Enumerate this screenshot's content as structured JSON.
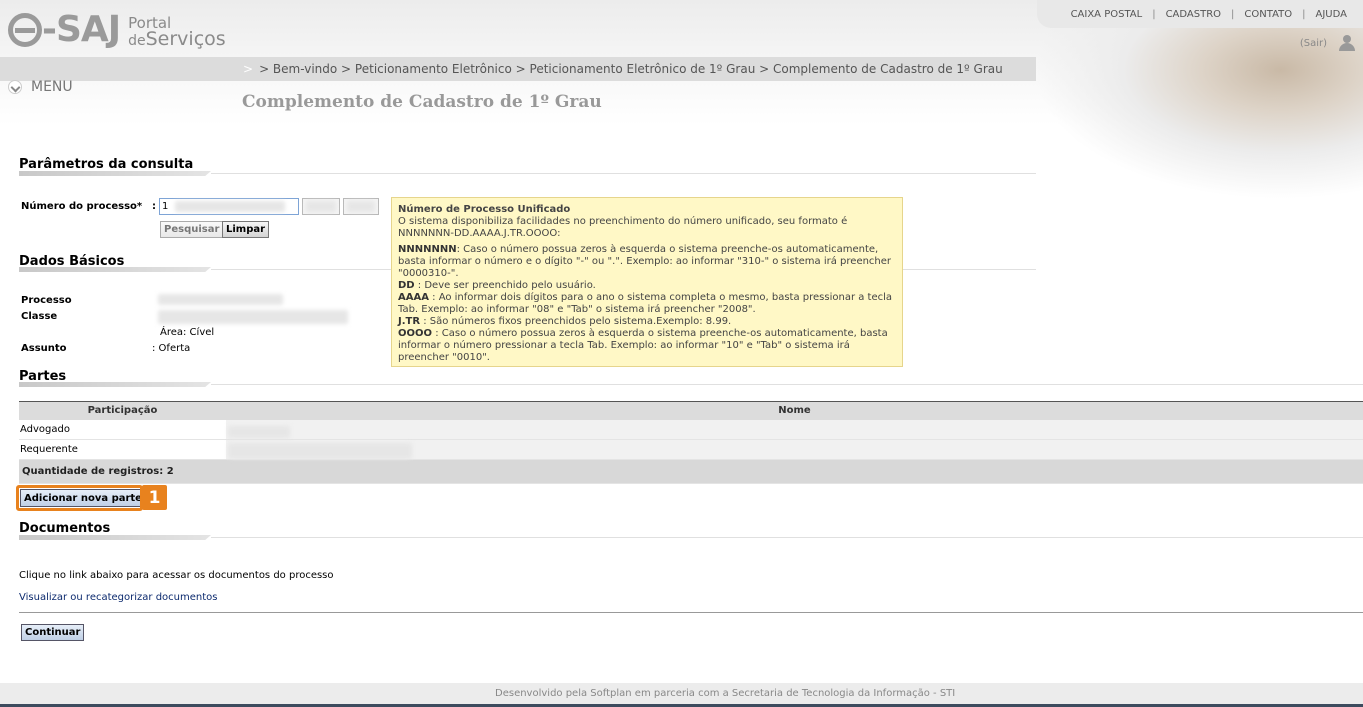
{
  "header": {
    "logo_main": "-SAJ",
    "logo_line1": "Portal",
    "logo_line2_small": "de",
    "logo_line2": "Serviços",
    "top_links": [
      "CAIXA POSTAL",
      "CADASTRO",
      "CONTATO",
      "AJUDA"
    ],
    "separator": "|",
    "logout": "(Sair)",
    "menu_label": "MENU",
    "breadcrumb_arrow": ">",
    "breadcrumb": "> Bem-vindo > Peticionamento Eletrônico > Peticionamento Eletrônico de 1º Grau > Complemento de Cadastro de 1º Grau",
    "page_title": "Complemento de Cadastro de 1º Grau"
  },
  "params": {
    "section_title": "Parâmetros da consulta",
    "process_label": "Número do processo*",
    "colon": ":",
    "process_value": "1",
    "search_button": "Pesquisar",
    "clear_button": "Limpar"
  },
  "tooltip": {
    "title": "Número de Processo Unificado",
    "intro": "O sistema disponibiliza facilidades no preenchimento do número unificado, seu formato é NNNNNNN-DD.AAAA.J.TR.OOOO:",
    "items": [
      {
        "key": "NNNNNNN",
        "text": ": Caso o número possua zeros à esquerda o sistema preenche-os automaticamente, basta informar o número e o dígito \"-\" ou \".\". Exemplo: ao informar \"310-\" o sistema irá preencher \"0000310-\"."
      },
      {
        "key": "DD",
        "text": " : Deve ser preenchido pelo usuário."
      },
      {
        "key": "AAAA",
        "text": " : Ao informar dois dígitos para o ano o sistema completa o mesmo, basta pressionar a tecla Tab. Exemplo: ao informar \"08\" e \"Tab\" o sistema irá preencher \"2008\"."
      },
      {
        "key": "J.TR",
        "text": " : São números fixos preenchidos pelo sistema.Exemplo: 8.99."
      },
      {
        "key": "OOOO",
        "text": " : Caso o número possua zeros à esquerda o sistema preenche-os automaticamente, basta informar o número pressionar a tecla Tab. Exemplo: ao informar \"10\" e \"Tab\" o sistema irá preencher \"0010\"."
      }
    ]
  },
  "basic": {
    "section_title": "Dados Básicos",
    "processo_label": "Processo",
    "classe_label": "Classe",
    "area_text": "Área: Cível",
    "assunto_label": "Assunto",
    "assunto_value": ": Oferta"
  },
  "partes": {
    "section_title": "Partes",
    "col_participacao": "Participação",
    "col_nome": "Nome",
    "rows": [
      {
        "participacao": "Advogado"
      },
      {
        "participacao": "Requerente"
      }
    ],
    "total": "Quantidade de registros: 2",
    "add_button": "Adicionar nova parte",
    "badge": "1"
  },
  "documentos": {
    "section_title": "Documentos",
    "info": "Clique no link abaixo para acessar os documentos do processo",
    "link": "Visualizar ou recategorizar documentos"
  },
  "continue_button": "Continuar",
  "footer": "Desenvolvido pela Softplan em parceria com a Secretaria de Tecnologia da Informação - STI",
  "colors": {
    "highlight": "#e8821e",
    "link": "#0c2a6e",
    "tooltip_bg": "#fff8c6"
  }
}
